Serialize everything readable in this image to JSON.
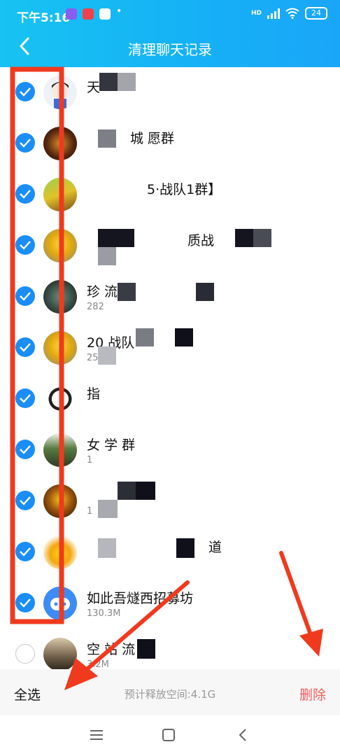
{
  "status": {
    "time": "下午5:16",
    "network": "HD",
    "battery": "24"
  },
  "header": {
    "title": "清理聊天记录"
  },
  "chats": [
    {
      "name": "天",
      "size": "",
      "checked": true
    },
    {
      "name": "城 愿群",
      "size": "",
      "checked": true
    },
    {
      "name": "5·战队1群】",
      "size": "",
      "checked": true
    },
    {
      "name": "质战",
      "size": "",
      "checked": true
    },
    {
      "name": "珍 流群",
      "size": "282",
      "checked": true
    },
    {
      "name": "20 战队",
      "size": "25",
      "checked": true
    },
    {
      "name": "指",
      "size": "",
      "checked": true
    },
    {
      "name": "女 学 群",
      "size": "1",
      "checked": true
    },
    {
      "name": "",
      "size": "1",
      "checked": true
    },
    {
      "name": "道",
      "size": "",
      "checked": true
    },
    {
      "name": "如此吾燧西招募坊",
      "size": "130.3M",
      "checked": true
    },
    {
      "name": "空 站 流",
      "size": "3.2M",
      "checked": false
    }
  ],
  "footer": {
    "select_all": "全选",
    "free_space": "预计释放空间:4.1G",
    "delete": "删除"
  },
  "colors": {
    "header": "#16b0f6",
    "check": "#1a8ef6",
    "delete": "#f05a5a",
    "annotation": "#f03a1e"
  },
  "icons": {
    "back": "chevron-left-icon",
    "check": "checkmark-icon",
    "nav_menu": "menu-icon",
    "nav_home": "square-home-icon",
    "nav_back": "triangle-back-icon"
  }
}
